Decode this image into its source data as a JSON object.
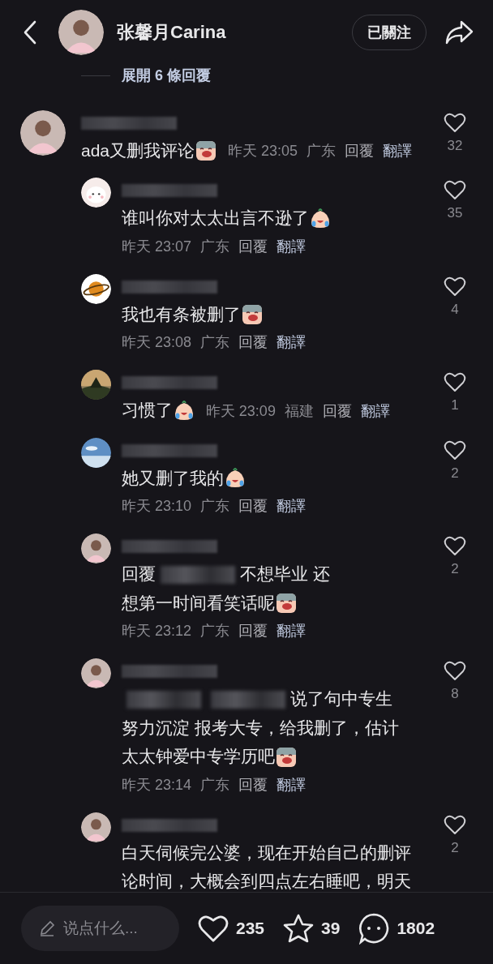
{
  "header": {
    "name": "张馨月Carina",
    "follow_button": "已關注"
  },
  "expand_replies": "展開 6 條回覆",
  "comments": [
    {
      "kind": "top",
      "segments": [
        {
          "kind": "text",
          "text": "ada又删我评论"
        },
        {
          "kind": "shock"
        }
      ],
      "same_line": true,
      "time": "昨天 23:05",
      "region": "广东",
      "reply": "回覆",
      "translate": "翻譯",
      "likes": "32"
    },
    {
      "kind": "reply",
      "segments": [
        {
          "kind": "text",
          "text": "谁叫你对太太出言不逊了"
        },
        {
          "kind": "cry"
        }
      ],
      "same_line": false,
      "time": "昨天 23:07",
      "region": "广东",
      "reply": "回覆",
      "translate": "翻譯",
      "likes": "35"
    },
    {
      "kind": "reply",
      "segments": [
        {
          "kind": "text",
          "text": "我也有条被删了"
        },
        {
          "kind": "shock"
        }
      ],
      "same_line": false,
      "time": "昨天 23:08",
      "region": "广东",
      "reply": "回覆",
      "translate": "翻譯",
      "likes": "4"
    },
    {
      "kind": "reply",
      "segments": [
        {
          "kind": "text",
          "text": "习惯了"
        },
        {
          "kind": "cry"
        }
      ],
      "same_line": true,
      "time": "昨天 23:09",
      "region": "福建",
      "reply": "回覆",
      "translate": "翻譯",
      "likes": "1"
    },
    {
      "kind": "reply",
      "segments": [
        {
          "kind": "text",
          "text": "她又删了我的"
        },
        {
          "kind": "cry"
        }
      ],
      "same_line": false,
      "time": "昨天 23:10",
      "region": "广东",
      "reply": "回覆",
      "translate": "翻譯",
      "likes": "2"
    },
    {
      "kind": "reply",
      "segments": [
        {
          "kind": "text",
          "text": "回覆"
        },
        {
          "kind": "blur"
        },
        {
          "kind": "text",
          "text": "不想毕业 还"
        },
        {
          "kind": "text",
          "text": "想第一时间看笑话呢"
        },
        {
          "kind": "shock"
        }
      ],
      "same_line": false,
      "time": "昨天 23:12",
      "region": "广东",
      "reply": "回覆",
      "translate": "翻譯",
      "likes": "2"
    },
    {
      "kind": "reply",
      "segments": [
        {
          "kind": "blur"
        },
        {
          "kind": "blur"
        },
        {
          "kind": "text",
          "text": "说了句中专生"
        },
        {
          "kind": "text",
          "text": "努力沉淀 报考大专，给我删了，估计"
        },
        {
          "kind": "text",
          "text": "太太钟爱中专学历吧"
        },
        {
          "kind": "shock"
        }
      ],
      "same_line": false,
      "time": "昨天 23:14",
      "region": "广东",
      "reply": "回覆",
      "translate": "翻譯",
      "likes": "8"
    },
    {
      "kind": "reply",
      "segments": [
        {
          "kind": "text",
          "text": "白天伺候完公婆，现在开始自己的删评"
        },
        {
          "kind": "text",
          "text": "论时间，大概会到四点左右睡吧，明天"
        }
      ],
      "likes": "2"
    }
  ],
  "bottom_bar": {
    "placeholder": "说点什么...",
    "likes": "235",
    "favorites": "39",
    "comments": "1802"
  }
}
